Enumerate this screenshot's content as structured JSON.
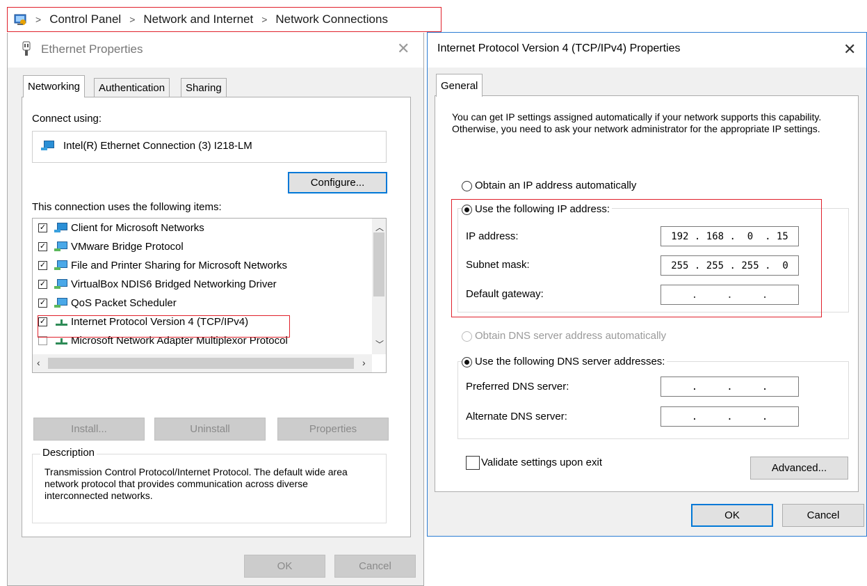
{
  "breadcrumb": {
    "items": [
      "Control Panel",
      "Network and Internet",
      "Network Connections"
    ],
    "separator": ">"
  },
  "ethernet": {
    "title": "Ethernet Properties",
    "tabs": [
      "Networking",
      "Authentication",
      "Sharing"
    ],
    "connect_using_label": "Connect using:",
    "adapter": "Intel(R) Ethernet Connection (3) I218-LM",
    "configure_label": "Configure...",
    "items_label": "This connection uses the following items:",
    "items": [
      {
        "label": "Client for Microsoft Networks",
        "checked": true,
        "icon": "network-client-icon"
      },
      {
        "label": "VMware Bridge Protocol",
        "checked": true,
        "icon": "network-service-icon"
      },
      {
        "label": "File and Printer Sharing for Microsoft Networks",
        "checked": true,
        "icon": "network-service-icon"
      },
      {
        "label": "VirtualBox NDIS6 Bridged Networking Driver",
        "checked": true,
        "icon": "network-service-icon"
      },
      {
        "label": "QoS Packet Scheduler",
        "checked": true,
        "icon": "network-service-icon"
      },
      {
        "label": "Internet Protocol Version 4 (TCP/IPv4)",
        "checked": true,
        "icon": "protocol-icon"
      },
      {
        "label": "Microsoft Network Adapter Multiplexor Protocol",
        "checked": false,
        "icon": "protocol-icon"
      }
    ],
    "install_label": "Install...",
    "uninstall_label": "Uninstall",
    "properties_label": "Properties",
    "description_title": "Description",
    "description_text": "Transmission Control Protocol/Internet Protocol. The default wide area network protocol that provides communication across diverse interconnected networks.",
    "ok_label": "OK",
    "cancel_label": "Cancel"
  },
  "ipv4": {
    "title": "Internet Protocol Version 4 (TCP/IPv4) Properties",
    "tab": "General",
    "intro": "You can get IP settings assigned automatically if your network supports this capability. Otherwise, you need to ask your network administrator for the appropriate IP settings.",
    "obtain_ip_auto": "Obtain an IP address automatically",
    "use_ip": "Use the following IP address:",
    "ip_address_label": "IP address:",
    "ip_address_value": "192 . 168 .  0  . 15",
    "subnet_label": "Subnet mask:",
    "subnet_value": "255 . 255 . 255 .  0",
    "gateway_label": "Default gateway:",
    "gateway_value": " .     .     . ",
    "obtain_dns_auto": "Obtain DNS server address automatically",
    "use_dns": "Use the following DNS server addresses:",
    "preferred_dns_label": "Preferred DNS server:",
    "preferred_dns_value": " .     .     . ",
    "alternate_dns_label": "Alternate DNS server:",
    "alternate_dns_value": " .     .     . ",
    "validate_label": "Validate settings upon exit",
    "advanced_label": "Advanced...",
    "ok_label": "OK",
    "cancel_label": "Cancel"
  },
  "colors": {
    "highlight_red": "#e0202a",
    "accent_blue": "#0078d7"
  }
}
